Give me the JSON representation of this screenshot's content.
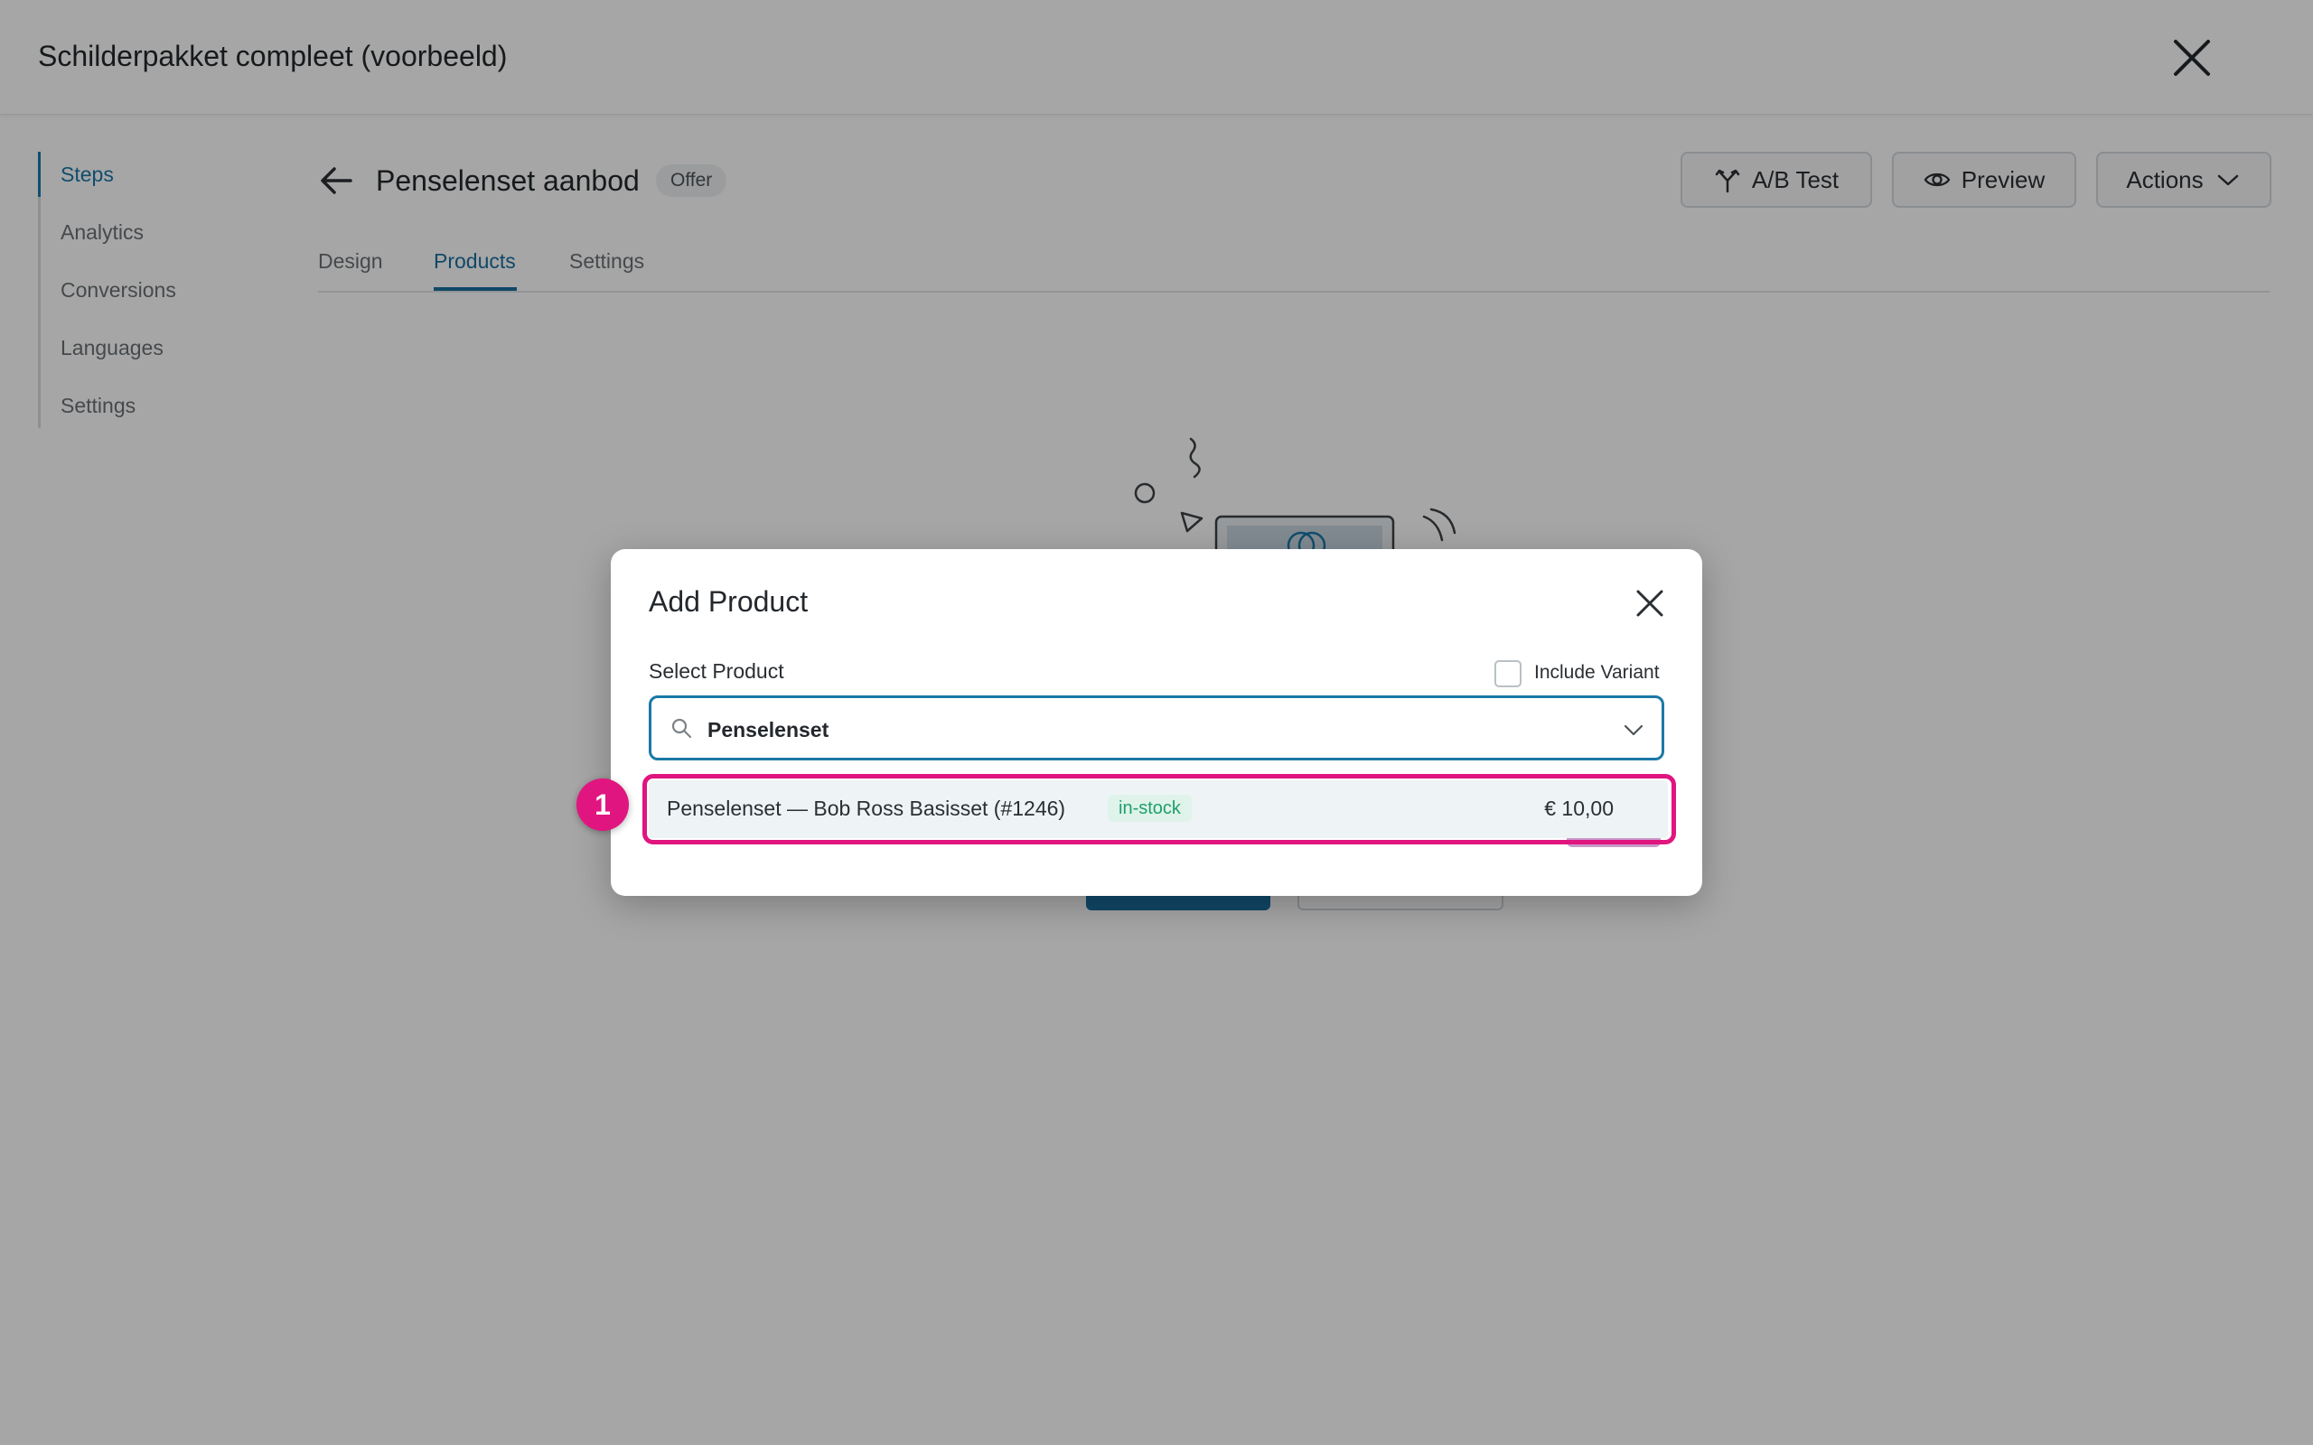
{
  "app": {
    "title": "Schilderpakket compleet (voorbeeld)",
    "close_icon": "close-icon"
  },
  "sidebar": {
    "items": [
      {
        "label": "Steps",
        "active": true
      },
      {
        "label": "Analytics",
        "active": false
      },
      {
        "label": "Conversions",
        "active": false
      },
      {
        "label": "Languages",
        "active": false
      },
      {
        "label": "Settings",
        "active": false
      }
    ]
  },
  "header": {
    "back_icon": "arrow-left-icon",
    "title": "Penselenset aanbod",
    "badge": "Offer",
    "buttons": {
      "ab_test": {
        "label": "A/B Test",
        "icon": "split-icon"
      },
      "preview": {
        "label": "Preview",
        "icon": "eye-icon"
      },
      "actions": {
        "label": "Actions",
        "icon": "chevron-down-icon"
      }
    }
  },
  "tabs": [
    {
      "label": "Design",
      "active": false
    },
    {
      "label": "Products",
      "active": true
    },
    {
      "label": "Settings",
      "active": false
    }
  ],
  "modal": {
    "title": "Add Product",
    "close_icon": "close-icon",
    "field_label": "Select Product",
    "include_variant": {
      "label": "Include Variant",
      "checked": false
    },
    "search": {
      "value": "Penselenset",
      "icon": "search-icon",
      "chevron": "chevron-down-icon"
    },
    "options": [
      {
        "name": "Penselenset — Bob Ross Basisset (#1246)",
        "stock": "in-stock",
        "price": "€ 10,00"
      }
    ]
  },
  "annotation": {
    "marker": "1"
  },
  "colors": {
    "accent": "#1a78a8",
    "highlight": "#e0157f",
    "stock_green": "#1f9f6c",
    "overlay": "rgba(0,0,0,0.35)"
  }
}
